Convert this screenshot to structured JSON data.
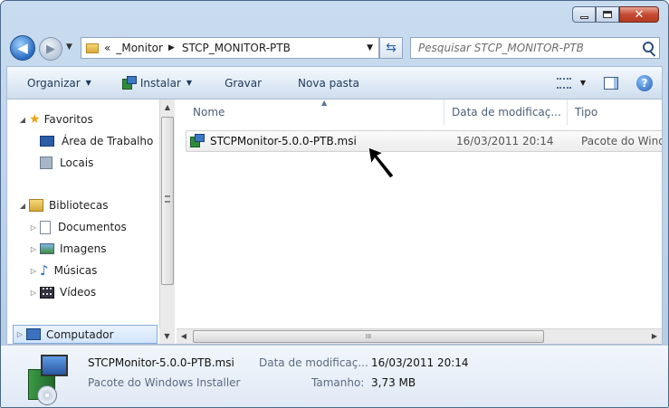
{
  "window": {
    "min_glyph": "",
    "max_glyph": "",
    "close_glyph": "✕"
  },
  "navigation": {
    "address": {
      "overflow": "«",
      "segments": [
        "_Monitor",
        "STCP_MONITOR-PTB"
      ]
    },
    "search_placeholder": "Pesquisar STCP_MONITOR-PTB"
  },
  "toolbar": {
    "organize": "Organizar",
    "install": "Instalar",
    "burn": "Gravar",
    "new_folder": "Nova pasta"
  },
  "sidebar": {
    "favorites": {
      "label": "Favoritos",
      "items": [
        "Área de Trabalho",
        "Locais"
      ]
    },
    "libraries": {
      "label": "Bibliotecas",
      "items": [
        "Documentos",
        "Imagens",
        "Músicas",
        "Vídeos"
      ]
    },
    "computer": "Computador"
  },
  "columns": {
    "name": "Nome",
    "date": "Data de modificaç...",
    "type": "Tipo"
  },
  "files": [
    {
      "name": "STCPMonitor-5.0.0-PTB.msi",
      "date": "16/03/2011 20:14",
      "type": "Pacote do Windows Installer"
    }
  ],
  "details": {
    "name": "STCPMonitor-5.0.0-PTB.msi",
    "date_label": "Data de modificaç...",
    "date_value": "16/03/2011 20:14",
    "type": "Pacote do Windows Installer",
    "size_label": "Tamanho:",
    "size_value": "3,73 MB"
  }
}
